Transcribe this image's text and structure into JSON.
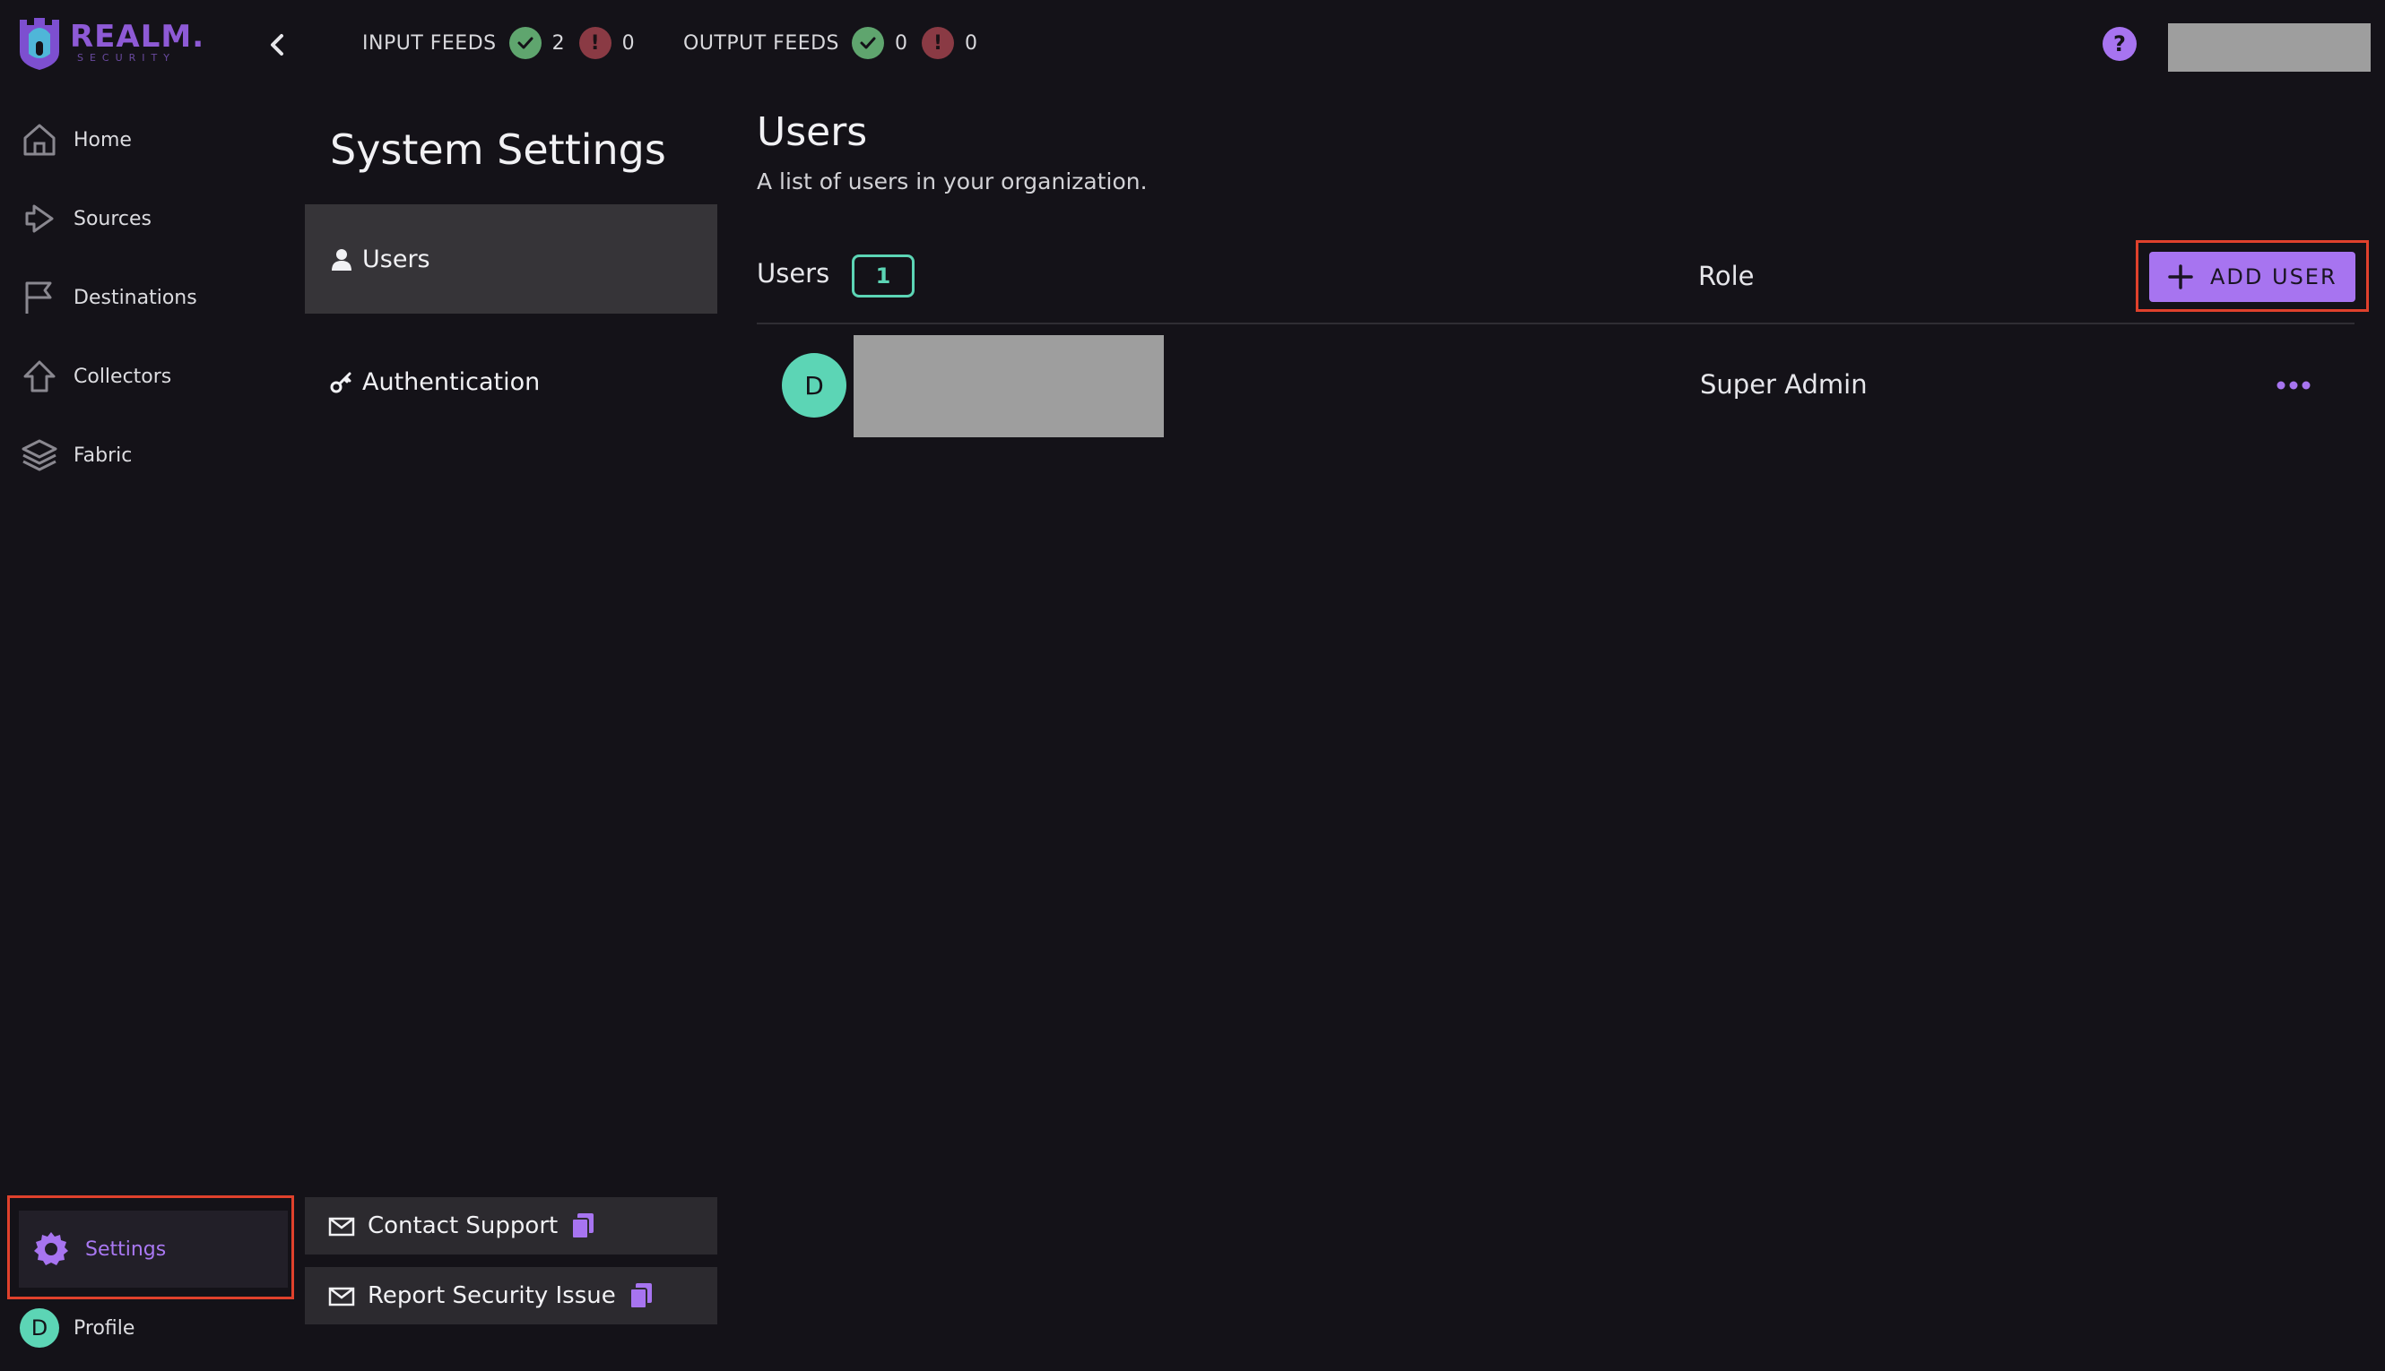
{
  "logo": {
    "word": "REALM.",
    "sub": "SECURITY"
  },
  "topbar": {
    "input_feeds": {
      "label": "INPUT FEEDS",
      "ok": "2",
      "err": "0",
      "err_glyph": "!"
    },
    "output_feeds": {
      "label": "OUTPUT FEEDS",
      "ok": "0",
      "err": "0",
      "err_glyph": "!"
    },
    "help_glyph": "?"
  },
  "nav": {
    "home": "Home",
    "sources": "Sources",
    "destinations": "Destinations",
    "collectors": "Collectors",
    "fabric": "Fabric",
    "settings": "Settings",
    "profile": "Profile",
    "profile_initial": "D"
  },
  "settings": {
    "title": "System Settings",
    "items": {
      "users": "Users",
      "authentication": "Authentication"
    },
    "footer": {
      "contact": "Contact Support",
      "report": "Report Security Issue"
    }
  },
  "main": {
    "title": "Users",
    "subtitle": "A list of users in your organization.",
    "table": {
      "col_users": "Users",
      "count": "1",
      "col_role": "Role",
      "add_label": "ADD USER",
      "rows": [
        {
          "initial": "D",
          "role": "Super Admin"
        }
      ]
    }
  },
  "colors": {
    "accent": "#a774f0",
    "teal": "#5cd5b5",
    "ok": "#5fa56e",
    "err": "#8a3a44",
    "highlight": "#e0412c",
    "bg": "#141218"
  }
}
